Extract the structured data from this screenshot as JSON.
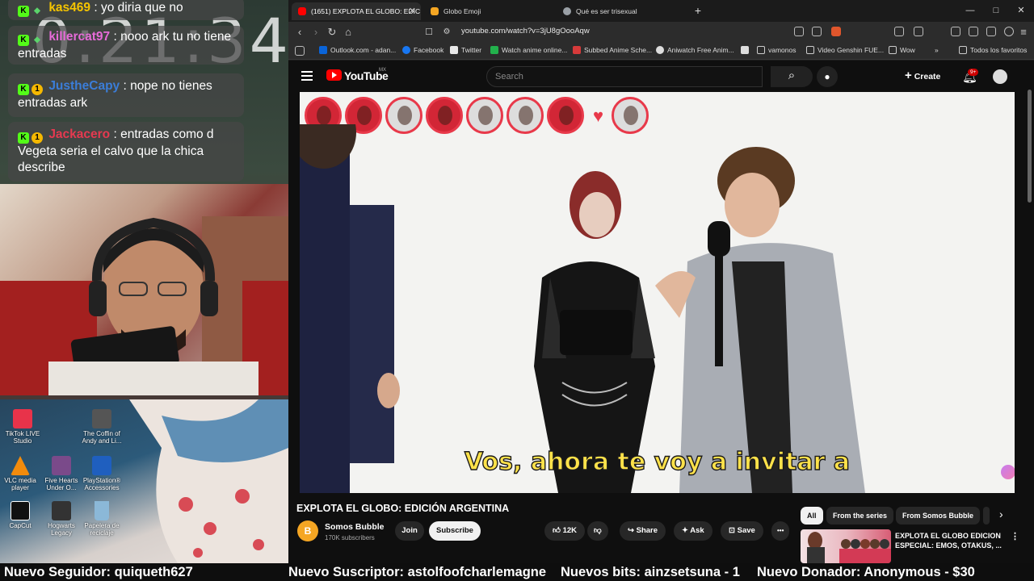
{
  "overlay": {
    "clock": "0:21:34",
    "chat": [
      {
        "user": "kas469",
        "text": ": yo diria que no",
        "user_color": "#f5c400"
      },
      {
        "user": "killercat97",
        "text": ": nooo ark tu no tiene entradas",
        "user_color": "#e66bd8"
      },
      {
        "user": "JustheCapy",
        "text": ": nope no tienes entradas ark",
        "user_color": "#3b7dd8"
      },
      {
        "user": "Jackacero",
        "text": ": entradas como d Vegeta seria el calvo que la chica describe",
        "user_color": "#e63950"
      }
    ],
    "desktop_icons": [
      {
        "label": "TikTok LIVE Studio",
        "icon": "tiktok-icon",
        "color": "#e8334a"
      },
      {
        "label": "The Coffin of Andy and Li...",
        "icon": "game-icon",
        "color": "#555555"
      },
      {
        "label": "VLC media player",
        "icon": "vlc-icon",
        "color": "#f28b0c"
      },
      {
        "label": "Five Hearts Under O...",
        "icon": "game-icon",
        "color": "#7a4a8a"
      },
      {
        "label": "PlayStation® Accessories",
        "icon": "playstation-icon",
        "color": "#1f5fbf"
      },
      {
        "label": "CapCut",
        "icon": "capcut-icon",
        "color": "#111111"
      },
      {
        "label": "Hogwarts Legacy",
        "icon": "game-icon",
        "color": "#333333"
      },
      {
        "label": "Papelera de reciclaje",
        "icon": "recycle-bin-icon",
        "color": "#8bb8d8"
      }
    ]
  },
  "ticker": {
    "follower": "Nuevo Seguidor: quiqueth627",
    "subscriber": "Nuevo Suscriptor: astolfoofcharlemagne",
    "bits": "Nuevos bits: ainzsetsuna - 1",
    "donor": "Nuevo Donador: Anonymous - $30"
  },
  "browser": {
    "tabs": [
      {
        "label": "(1651) EXPLOTA EL GLOBO: EDIC",
        "active": true,
        "favicon_color": "#ff0000"
      },
      {
        "label": "Globo Emoji",
        "active": false,
        "favicon_color": "#f5a623"
      },
      {
        "label": "Qué es ser trisexual",
        "active": false,
        "favicon_color": "#9aa0a6"
      }
    ],
    "new_tab": "+",
    "url": "youtube.com/watch?v=3jU8gOooAqw",
    "bookmarks": [
      {
        "label": "Outlook.com - adan...",
        "color": "#0a64d8"
      },
      {
        "label": "Facebook",
        "color": "#1877f2"
      },
      {
        "label": "Twitter",
        "color": "#e8e8e8"
      },
      {
        "label": "Watch anime online...",
        "color": "#22b14c"
      },
      {
        "label": "Subbed Anime Sche...",
        "color": "#d63a3a"
      },
      {
        "label": "Aniwatch Free Anim...",
        "color": "#dddddd"
      },
      {
        "label": "",
        "color": "#dddddd"
      },
      {
        "label": "vamonos",
        "color": "#dddddd"
      },
      {
        "label": "Video Genshin FUE...",
        "color": "#dddddd"
      },
      {
        "label": "Wow",
        "color": "#dddddd"
      }
    ],
    "bookmarks_more": "»",
    "all_favorites": "Todos los favoritos"
  },
  "youtube": {
    "brand": "YouTube",
    "region": "MX",
    "search_placeholder": "Search",
    "create_label": "Create",
    "notifications": "9+",
    "subtitle": "Vos, ahora te voy a invitar a",
    "video_title": "EXPLOTA EL GLOBO: EDICIÓN ARGENTINA",
    "channel": {
      "name": "Somos Bubble",
      "subscribers": "170K subscribers",
      "avatar_letter": "B"
    },
    "join_label": "Join",
    "subscribe_label": "Subscribe",
    "likes": "12K",
    "share_label": "Share",
    "ask_label": "Ask",
    "save_label": "Save",
    "more_label": "•••",
    "chips": [
      "All",
      "From the series",
      "From Somos Bubble"
    ],
    "recommended": {
      "title": "EXPLOTA EL GLOBO EDICION ESPECIAL: EMOS, OTAKUS, ..."
    }
  }
}
